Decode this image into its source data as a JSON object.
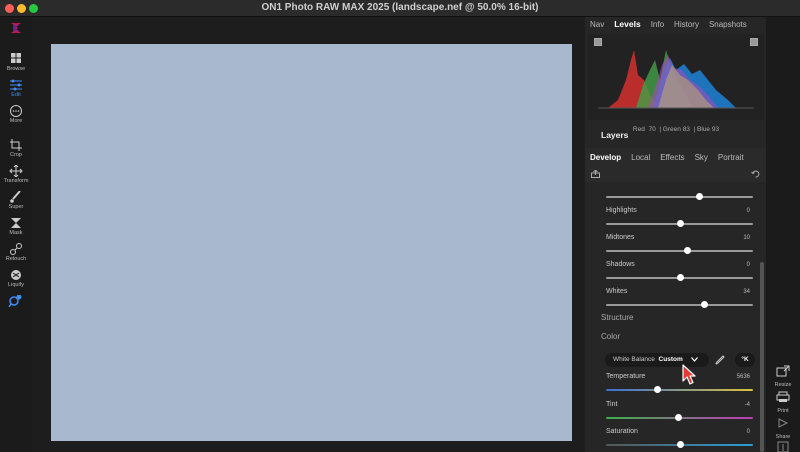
{
  "window": {
    "title": "ON1 Photo RAW MAX 2025 (landscape.nef @ 50.0% 16-bit)"
  },
  "left_tools": [
    {
      "label": "Browse",
      "icon": "grid-icon"
    },
    {
      "label": "Edit",
      "icon": "sliders-icon"
    },
    {
      "label": "More",
      "icon": "more-icon"
    },
    {
      "label": "Crop",
      "icon": "crop-icon"
    },
    {
      "label": "Transform",
      "icon": "move-icon"
    },
    {
      "label": "Super",
      "icon": "brush-icon"
    },
    {
      "label": "Mask",
      "icon": "mask-icon"
    },
    {
      "label": "Retouch",
      "icon": "retouch-icon"
    },
    {
      "label": "Liquify",
      "icon": "liquify-icon"
    },
    {
      "label": "",
      "icon": "zoom-icon"
    }
  ],
  "panel_tabs": [
    "Nav",
    "Levels",
    "Info",
    "History",
    "Snapshots"
  ],
  "active_panel_tab": "Levels",
  "histogram": {
    "red_label": "Red",
    "red": "70",
    "green_label": "| Green",
    "green": "83",
    "blue_label": "| Blue",
    "blue": "93"
  },
  "layers_heading": "Layers",
  "develop_tabs": [
    "Develop",
    "Local",
    "Effects",
    "Sky",
    "Portrait"
  ],
  "active_develop_tab": "Develop",
  "sliders": [
    {
      "name": "",
      "value": "",
      "position": 0.63
    },
    {
      "name": "Highlights",
      "value": "0",
      "position": 0.5
    },
    {
      "name": "Midtones",
      "value": "10",
      "position": 0.55
    },
    {
      "name": "Shadows",
      "value": "0",
      "position": 0.5
    },
    {
      "name": "Whites",
      "value": "34",
      "position": 0.67
    }
  ],
  "structure_label": "Structure",
  "color_label": "Color",
  "white_balance": {
    "label": "White Balance",
    "value": "Custom",
    "kelvin_button": "°K"
  },
  "color_sliders": [
    {
      "name": "Temperature",
      "value": "5636",
      "position": 0.35
    },
    {
      "name": "Tint",
      "value": "-4",
      "position": 0.49
    },
    {
      "name": "Saturation",
      "value": "0",
      "position": 0.5
    }
  ],
  "right_tools": [
    {
      "label": "Resize",
      "icon": "resize-icon"
    },
    {
      "label": "Print",
      "icon": "print-icon"
    },
    {
      "label": "Share",
      "icon": "share-icon"
    }
  ],
  "colors": {
    "accent": "#3d8ef7",
    "photo": "#a7b8cf"
  }
}
